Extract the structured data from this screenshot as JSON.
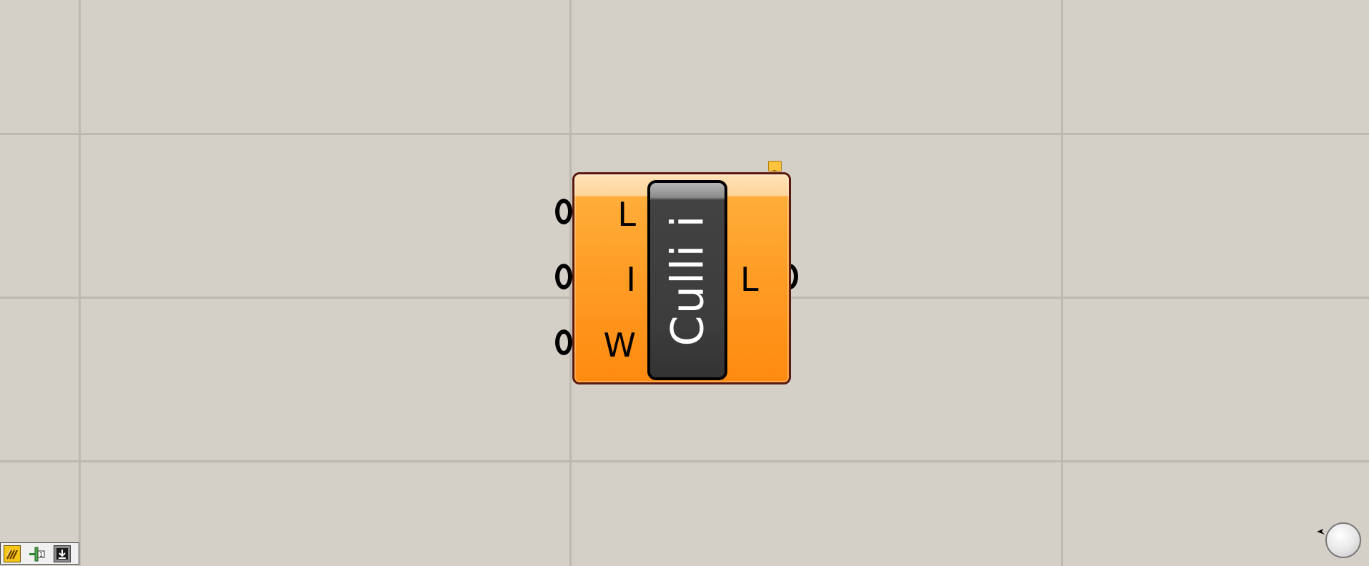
{
  "canvas": {
    "background": "#d4d0c8",
    "grid_color": "#bdb9b1"
  },
  "component": {
    "nickname": "Culli i",
    "body_color": "#ff9a22",
    "capsule_color": "#3c3c3c",
    "inputs": [
      {
        "label": "L"
      },
      {
        "label": "I"
      },
      {
        "label": "W"
      }
    ],
    "outputs": [
      {
        "label": "L"
      }
    ]
  },
  "statusbar": {
    "buttons": [
      {
        "icon": "canvas-preview-icon"
      },
      {
        "icon": "number-slider-icon"
      },
      {
        "icon": "download-icon"
      }
    ]
  },
  "navigation": {
    "icon": "navigation-compass-icon"
  }
}
